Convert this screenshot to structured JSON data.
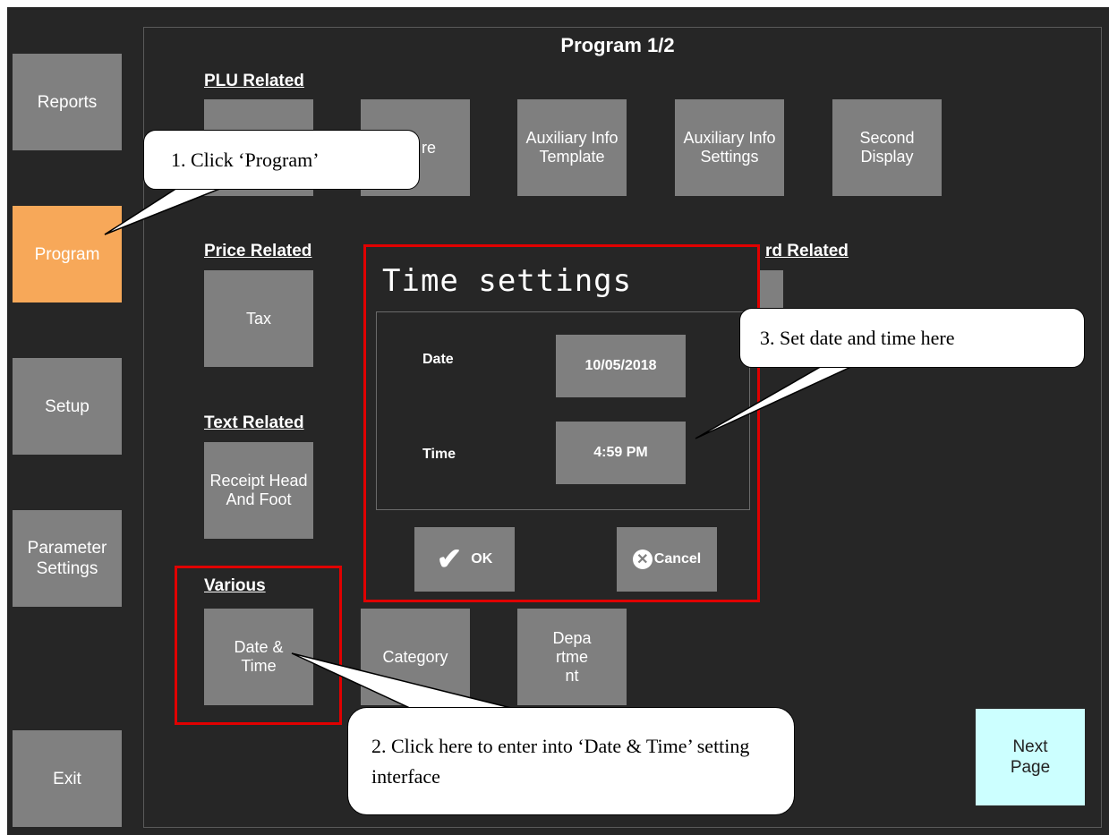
{
  "header": {
    "title": "Program 1/2"
  },
  "sidebar": {
    "items": [
      {
        "label": "Reports"
      },
      {
        "label": "Program"
      },
      {
        "label": "Setup"
      },
      {
        "label": "Parameter Settings"
      },
      {
        "label": "Exit"
      }
    ]
  },
  "sections": {
    "plu": {
      "heading": "PLU Related",
      "buttons": [
        "",
        "re",
        "Auxiliary Info Template",
        "Auxiliary Info Settings",
        "Second Display"
      ]
    },
    "price": {
      "heading": "Price Related",
      "buttons": [
        "Tax"
      ]
    },
    "keyboard": {
      "heading": "rd Related"
    },
    "text": {
      "heading": "Text Related",
      "buttons": [
        "Receipt Head And Foot"
      ]
    },
    "various": {
      "heading": "Various",
      "buttons": [
        "Date & Time",
        "Category",
        "Depa rtme nt"
      ]
    }
  },
  "next_page": {
    "label": "Next Page"
  },
  "dialog": {
    "title": "Time settings",
    "date_label": "Date",
    "date_value": "10/05/2018",
    "time_label": "Time",
    "time_value": "4:59 PM",
    "ok_label": "OK",
    "cancel_label": "Cancel"
  },
  "callouts": {
    "step1": "1. Click ‘Program’",
    "step2": "2. Click here to enter into ‘Date & Time’ setting interface",
    "step3": "3. Set date and time here"
  },
  "colors": {
    "background": "#262626",
    "button": "#7f7f7f",
    "active": "#f7a859",
    "next_page": "#ccffff",
    "highlight": "#e00000"
  }
}
